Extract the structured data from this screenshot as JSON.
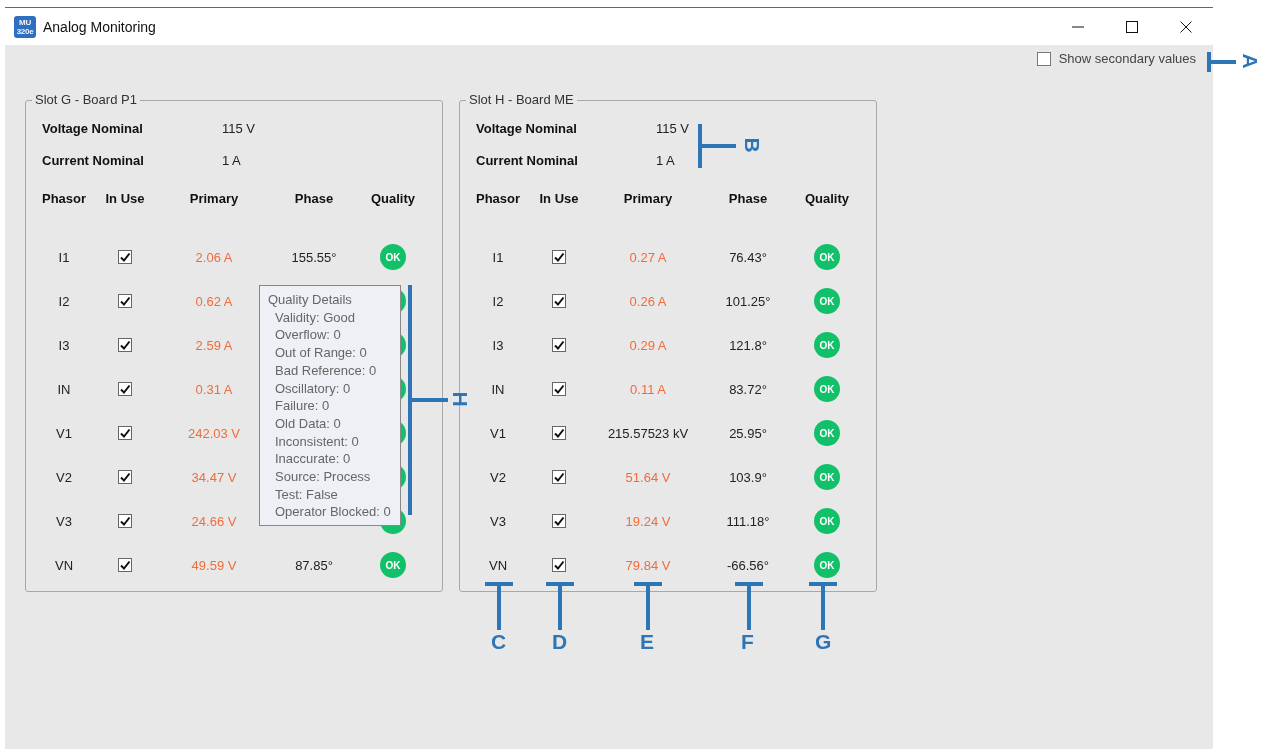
{
  "window": {
    "icon_lines": [
      "MU",
      "320e"
    ],
    "title": "Analog Monitoring"
  },
  "show_secondary": {
    "label": "Show secondary values",
    "checked": false
  },
  "panels": [
    {
      "title": "Slot G - Board P1",
      "nominals": [
        {
          "label": "Voltage Nominal",
          "value": "115 V"
        },
        {
          "label": "Current Nominal",
          "value": "1 A"
        }
      ],
      "columns": [
        "Phasor",
        "In Use",
        "Primary",
        "Phase",
        "Quality"
      ],
      "rows": [
        {
          "phasor": "I1",
          "in_use": true,
          "primary": "2.06 A",
          "primary_highlighted": true,
          "phase": "155.55°",
          "quality": "OK",
          "color": "#12c06a"
        },
        {
          "phasor": "I2",
          "in_use": true,
          "primary": "0.62 A",
          "primary_highlighted": true,
          "color": "#12c06a"
        },
        {
          "phasor": "I3",
          "in_use": true,
          "primary": "2.59 A",
          "primary_highlighted": true,
          "color": "#12c06a"
        },
        {
          "phasor": "IN",
          "in_use": true,
          "primary": "0.31 A",
          "primary_highlighted": true,
          "color": "#12c06a"
        },
        {
          "phasor": "V1",
          "in_use": true,
          "primary": "242.03 V",
          "primary_highlighted": true,
          "color": "#12c06a"
        },
        {
          "phasor": "V2",
          "in_use": true,
          "primary": "34.47 V",
          "primary_highlighted": true,
          "color": "#12c06a"
        },
        {
          "phasor": "V3",
          "in_use": true,
          "primary": "24.66 V",
          "primary_highlighted": true,
          "color": "#12c06a"
        },
        {
          "phasor": "VN",
          "in_use": true,
          "primary": "49.59 V",
          "primary_highlighted": true,
          "phase": "87.85°",
          "quality": "OK",
          "color": "#12c06a"
        }
      ],
      "tooltip": {
        "title": "Quality Details",
        "lines": [
          "Validity: Good",
          "Overflow: 0",
          "Out of Range: 0",
          "Bad Reference: 0",
          "Oscillatory: 0",
          "Failure: 0",
          "Old Data: 0",
          "Inconsistent: 0",
          "Inaccurate: 0",
          "Source: Process",
          "Test: False",
          "Operator Blocked: 0"
        ]
      }
    },
    {
      "title": "Slot H - Board ME",
      "nominals": [
        {
          "label": "Voltage Nominal",
          "value": "115 V"
        },
        {
          "label": "Current Nominal",
          "value": "1 A"
        }
      ],
      "columns": [
        "Phasor",
        "In Use",
        "Primary",
        "Phase",
        "Quality"
      ],
      "rows": [
        {
          "phasor": "I1",
          "in_use": true,
          "primary": "0.27 A",
          "primary_highlighted": true,
          "phase": "76.43°",
          "quality": "OK",
          "color": "#12c06a"
        },
        {
          "phasor": "I2",
          "in_use": true,
          "primary": "0.26 A",
          "primary_highlighted": true,
          "phase": "101.25°",
          "quality": "OK",
          "color": "#12c06a"
        },
        {
          "phasor": "I3",
          "in_use": true,
          "primary": "0.29 A",
          "primary_highlighted": true,
          "phase": "121.8°",
          "quality": "OK",
          "color": "#12c06a"
        },
        {
          "phasor": "IN",
          "in_use": true,
          "primary": "0.11 A",
          "primary_highlighted": true,
          "phase": "83.72°",
          "quality": "OK",
          "color": "#12c06a"
        },
        {
          "phasor": "V1",
          "in_use": true,
          "primary": "215.57523 kV",
          "primary_highlighted": false,
          "phase": "25.95°",
          "quality": "OK",
          "color": "#12c06a"
        },
        {
          "phasor": "V2",
          "in_use": true,
          "primary": "51.64 V",
          "primary_highlighted": true,
          "phase": "103.9°",
          "quality": "OK",
          "color": "#12c06a"
        },
        {
          "phasor": "V3",
          "in_use": true,
          "primary": "19.24 V",
          "primary_highlighted": true,
          "phase": "111.18°",
          "quality": "OK",
          "color": "#12c06a"
        },
        {
          "phasor": "VN",
          "in_use": true,
          "primary": "79.84 V",
          "primary_highlighted": true,
          "phase": "-66.56°",
          "quality": "OK",
          "color": "#12c06a"
        }
      ]
    }
  ],
  "callouts": [
    {
      "label": "A"
    },
    {
      "label": "B"
    },
    {
      "label": "C"
    },
    {
      "label": "D"
    },
    {
      "label": "E"
    },
    {
      "label": "F"
    },
    {
      "label": "G"
    },
    {
      "label": "H"
    }
  ]
}
